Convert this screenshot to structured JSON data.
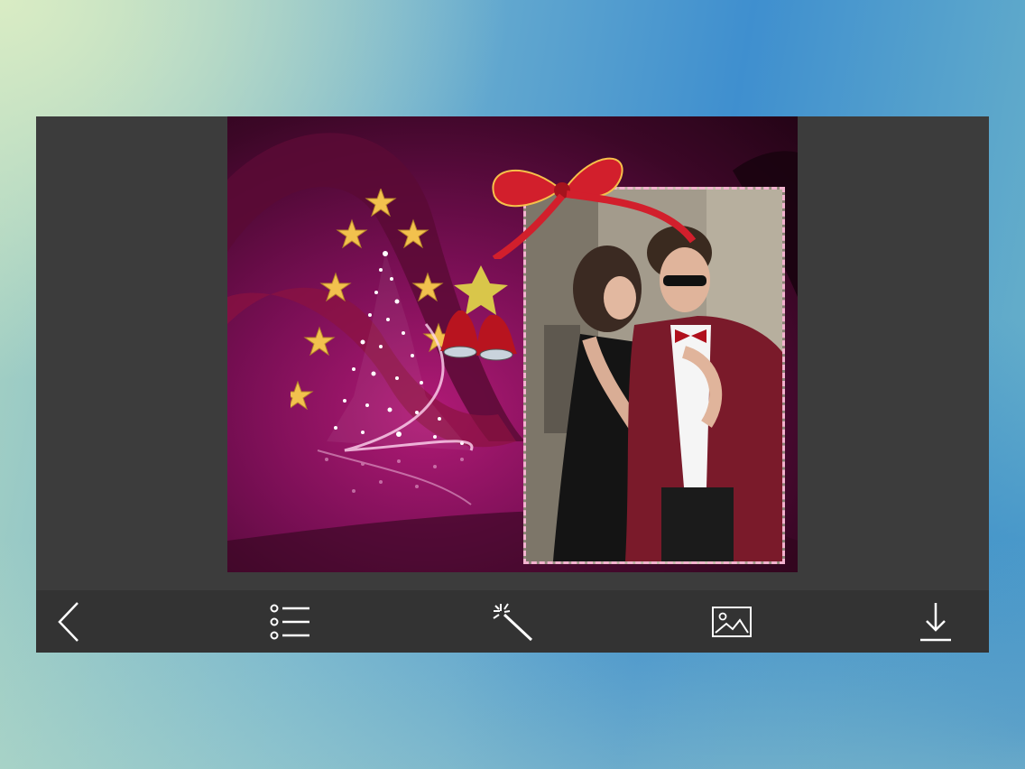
{
  "app": {
    "title": ""
  },
  "canvas": {
    "frame_theme": "christmas-photo-frame",
    "colors": {
      "background_dark": "#240416",
      "background_light": "#b01a76",
      "frame_border": "#f3b3cf",
      "star": "#f2c14e"
    }
  },
  "toolbar": {
    "items": [
      {
        "icon": "back-arrow-icon",
        "name": "back-button"
      },
      {
        "icon": "list-icon",
        "name": "menu-list-button"
      },
      {
        "icon": "magic-wand-icon",
        "name": "effects-button"
      },
      {
        "icon": "image-icon",
        "name": "gallery-button"
      },
      {
        "icon": "download-icon",
        "name": "save-button"
      }
    ],
    "colors": {
      "background": "#333333",
      "icon": "#ffffff"
    }
  }
}
